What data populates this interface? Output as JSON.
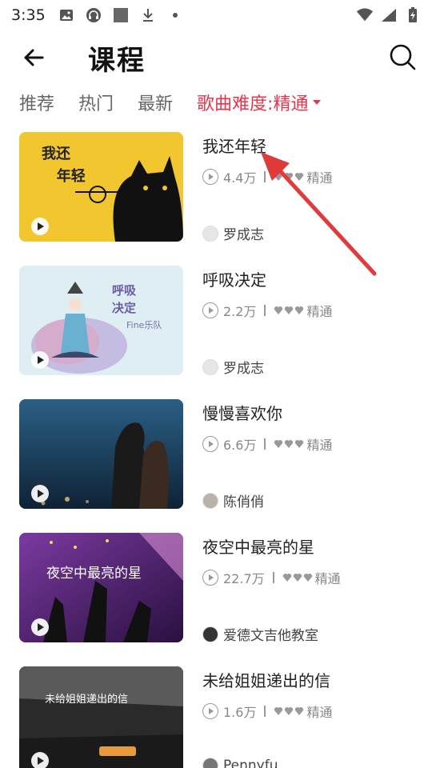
{
  "status_bar": {
    "time": "3:35",
    "left_icons": [
      "image-icon",
      "headphones-icon",
      "square-icon",
      "download-icon",
      "dot-icon"
    ],
    "right_icons": [
      "wifi-icon",
      "signal-icon",
      "battery-icon"
    ]
  },
  "header": {
    "title": "课程",
    "back_icon": "arrow-left-icon",
    "search_icon": "search-icon"
  },
  "tabs": [
    {
      "label": "推荐",
      "active": false
    },
    {
      "label": "热门",
      "active": false
    },
    {
      "label": "最新",
      "active": false
    },
    {
      "label": "歌曲难度:精通",
      "active": true
    }
  ],
  "accent_color": "#e8354d",
  "annotation": {
    "type": "red-arrow",
    "color": "#e03a3a",
    "points_to": "我还年轻"
  },
  "courses": [
    {
      "title": "我还年轻",
      "plays": "4.4万",
      "difficulty": "精通",
      "author": "罗成志",
      "thumb_text": "我还\n年轻",
      "thumb_bg": "#f2c62f"
    },
    {
      "title": "呼吸决定",
      "plays": "2.2万",
      "difficulty": "精通",
      "author": "罗成志",
      "thumb_text": "呼吸\n决定",
      "thumb_sub": "Fine乐队",
      "thumb_bg": "#dfeef3"
    },
    {
      "title": "慢慢喜欢你",
      "plays": "6.6万",
      "difficulty": "精通",
      "author": "陈俏俏",
      "thumb_bg": "#1f3d5c"
    },
    {
      "title": "夜空中最亮的星",
      "plays": "22.7万",
      "difficulty": "精通",
      "author": "爱德文吉他教室",
      "thumb_text": "夜空中最亮的星",
      "thumb_bg": "#5b2a7e"
    },
    {
      "title": "未给姐姐递出的信",
      "plays": "1.6万",
      "difficulty": "精通",
      "author": "Pennyfu",
      "thumb_text": "未给姐姐递出的信",
      "thumb_bg": "#2a2a2a"
    }
  ]
}
